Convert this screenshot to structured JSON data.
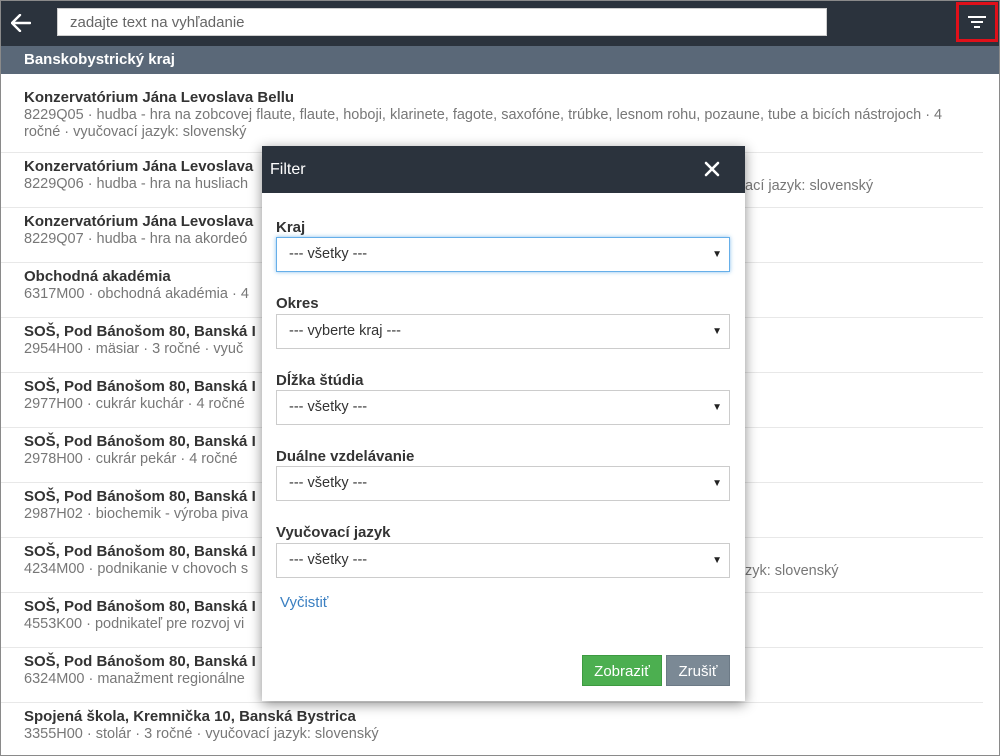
{
  "header": {
    "search_placeholder": "zadajte text na vyhľadanie",
    "back_icon": "arrow-left-icon",
    "filter_icon": "filter-icon"
  },
  "region": {
    "title": "Banskobystrický kraj"
  },
  "schools": [
    {
      "name": "Konzervatórium Jána Levoslava Bellu",
      "desc": "8229Q05 · hudba - hra na zobcovej flaute, flaute, hoboji, klarinete, fagote, saxofóne, trúbke, lesnom rohu, pozaune, tube a bicích nástrojoch · 4 ročné · vyučovací jazyk: slovenský"
    },
    {
      "name": "Konzervatórium Jána Levoslava",
      "desc": "8229Q06 · hudba - hra na husliach",
      "desc_tail": "ací jazyk: slovenský"
    },
    {
      "name": "Konzervatórium Jána Levoslava",
      "desc": "8229Q07 · hudba - hra na akordeó"
    },
    {
      "name": "Obchodná akadémia",
      "desc": "6317M00 · obchodná akadémia · 4"
    },
    {
      "name": "SOŠ, Pod Bánošom 80, Banská I",
      "desc": "2954H00 · mäsiar · 3 ročné · vyuč"
    },
    {
      "name": "SOŠ, Pod Bánošom 80, Banská I",
      "desc": "2977H00 · cukrár kuchár · 4 ročné"
    },
    {
      "name": "SOŠ, Pod Bánošom 80, Banská I",
      "desc": "2978H00 · cukrár pekár · 4 ročné"
    },
    {
      "name": "SOŠ, Pod Bánošom 80, Banská I",
      "desc": "2987H02 · biochemik - výroba piva"
    },
    {
      "name": "SOŠ, Pod Bánošom 80, Banská I",
      "desc": "4234M00 · podnikanie v chovoch s",
      "desc_tail": "zyk: slovenský"
    },
    {
      "name": "SOŠ, Pod Bánošom 80, Banská I",
      "desc": "4553K00 · podnikateľ pre rozvoj vi"
    },
    {
      "name": "SOŠ, Pod Bánošom 80, Banská I",
      "desc": "6324M00 · manažment regionálne"
    },
    {
      "name": "Spojená škola, Kremnička 10, Banská Bystrica",
      "desc": "3355H00 · stolár · 3 ročné · vyučovací jazyk: slovenský"
    }
  ],
  "filter_modal": {
    "title": "Filter",
    "close_icon": "close-icon",
    "fields": [
      {
        "label": "Kraj",
        "value": "--- všetky ---"
      },
      {
        "label": "Okres",
        "value": "--- vyberte kraj ---"
      },
      {
        "label": "Dĺžka štúdia",
        "value": "--- všetky ---"
      },
      {
        "label": "Duálne vzdelávanie",
        "value": "--- všetky ---"
      },
      {
        "label": "Vyučovací jazyk",
        "value": "--- všetky ---"
      }
    ],
    "clear_label": "Vyčistiť",
    "show_label": "Zobraziť",
    "cancel_label": "Zrušiť"
  },
  "colors": {
    "header_bg": "#2b333d",
    "region_bg": "#5a6878",
    "highlight_border": "#e0101a",
    "primary_button": "#4caf50",
    "secondary_button": "#7b8995",
    "link": "#3a7fc1"
  }
}
